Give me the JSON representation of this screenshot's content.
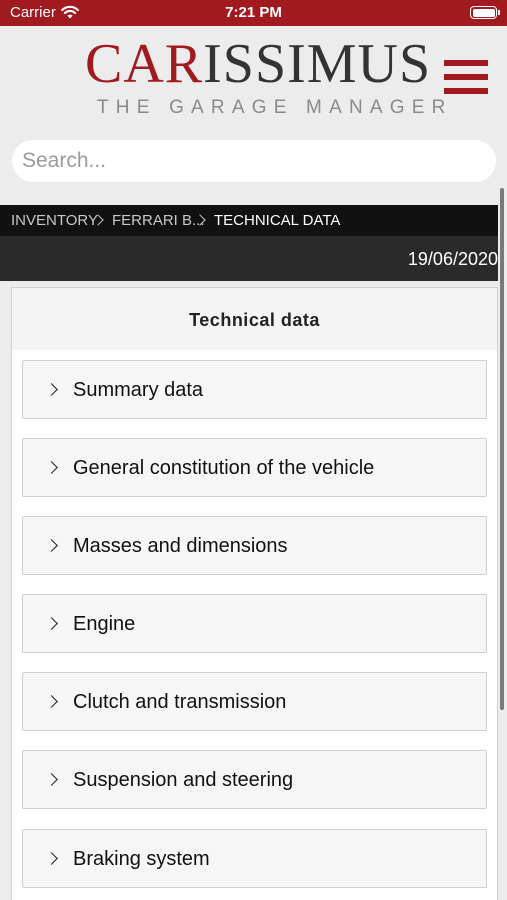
{
  "status_bar": {
    "carrier": "Carrier",
    "time": "7:21 PM"
  },
  "header": {
    "logo_red": "CAR",
    "logo_dark": "ISSIMUS",
    "tagline": "THE GARAGE MANAGER"
  },
  "search": {
    "placeholder": "Search...",
    "value": ""
  },
  "breadcrumb": {
    "items": [
      "INVENTORY",
      "FERRARI B...",
      "TECHNICAL DATA"
    ]
  },
  "date": "19/06/2020",
  "panel": {
    "title": "Technical data",
    "sections": [
      {
        "label": "Summary data"
      },
      {
        "label": "General constitution of the vehicle"
      },
      {
        "label": "Masses and dimensions"
      },
      {
        "label": "Engine"
      },
      {
        "label": "Clutch and transmission"
      },
      {
        "label": "Suspension and steering"
      },
      {
        "label": "Braking system"
      }
    ]
  },
  "colors": {
    "brand_red": "#a01a1f",
    "breadcrumb_bg": "#111111",
    "date_bar_bg": "#2a2a2a"
  },
  "icons": [
    "wifi-icon",
    "battery-icon",
    "menu-icon",
    "chevron-right-icon"
  ]
}
